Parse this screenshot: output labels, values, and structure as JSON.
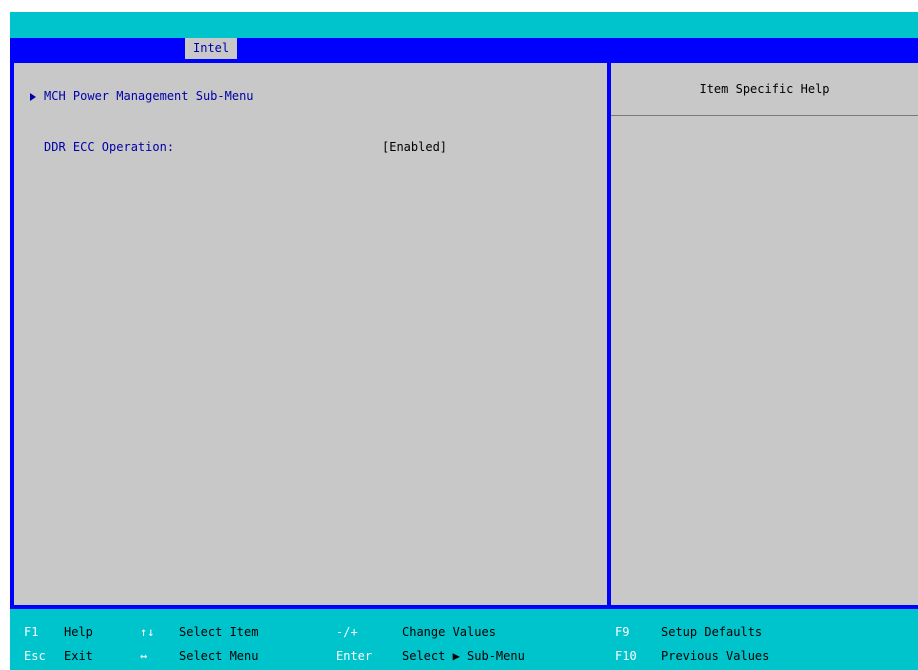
{
  "tabs": [
    {
      "label": "Intel",
      "active": true
    }
  ],
  "menu": {
    "submenu_label": "MCH Power Management Sub-Menu",
    "setting_label": "DDR ECC Operation:",
    "setting_value": "[Enabled]"
  },
  "help_panel": {
    "title": "Item Specific Help"
  },
  "footer": {
    "row1": [
      {
        "key": "F1",
        "desc": "Help"
      },
      {
        "key": "↑↓",
        "desc": "Select Item"
      },
      {
        "key": "-/+",
        "desc": "Change Values"
      },
      {
        "key": "F9",
        "desc": "Setup Defaults"
      }
    ],
    "row2": [
      {
        "key": "Esc",
        "desc": "Exit"
      },
      {
        "key": "↔",
        "desc": "Select Menu"
      },
      {
        "key": "Enter",
        "desc": "Select ▶ Sub-Menu"
      },
      {
        "key": "F10",
        "desc": "Previous Values"
      }
    ]
  },
  "colors": {
    "cyan": "#00c4cc",
    "blue": "#0000ff",
    "panel_gray": "#c8c8c8",
    "item_text": "#0000a8"
  }
}
